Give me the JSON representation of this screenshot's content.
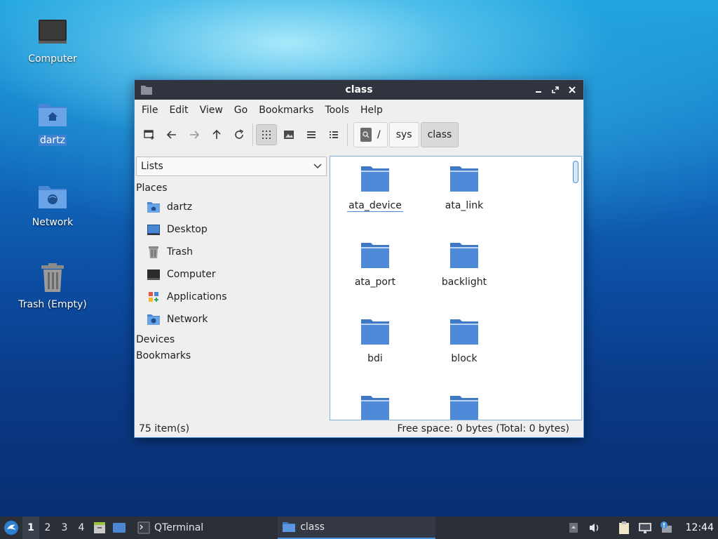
{
  "desktop": {
    "icons": [
      {
        "label": "Computer",
        "icon": "computer-icon"
      },
      {
        "label": "dartz",
        "icon": "home-folder-icon",
        "selected": true
      },
      {
        "label": "Network",
        "icon": "network-folder-icon"
      },
      {
        "label": "Trash (Empty)",
        "icon": "trash-icon"
      }
    ]
  },
  "window": {
    "title": "class",
    "menu": [
      "File",
      "Edit",
      "View",
      "Go",
      "Bookmarks",
      "Tools",
      "Help"
    ],
    "breadcrumb": [
      "/",
      "sys",
      "class"
    ],
    "side": {
      "view_mode": "Lists",
      "places_label": "Places",
      "places": [
        {
          "label": "dartz",
          "icon": "home-folder-icon"
        },
        {
          "label": "Desktop",
          "icon": "desktop-icon"
        },
        {
          "label": "Trash",
          "icon": "trash-icon"
        },
        {
          "label": "Computer",
          "icon": "computer-icon"
        },
        {
          "label": "Applications",
          "icon": "applications-icon"
        },
        {
          "label": "Network",
          "icon": "network-folder-icon"
        }
      ],
      "devices_label": "Devices",
      "bookmarks_label": "Bookmarks"
    },
    "files": [
      "ata_device",
      "ata_link",
      "ata_port",
      "backlight",
      "bdi",
      "block",
      "",
      ""
    ],
    "status": {
      "items": "75 item(s)",
      "free_space": "Free space: 0 bytes (Total: 0 bytes)"
    }
  },
  "taskbar": {
    "workspaces": [
      "1",
      "2",
      "3",
      "4"
    ],
    "active_workspace": "1",
    "tasks": [
      {
        "label": "QTerminal",
        "icon": "terminal-icon"
      },
      {
        "label": "class",
        "icon": "folder-icon",
        "active": true
      }
    ],
    "clock": "12:44"
  },
  "colors": {
    "folder": "#4a86d4",
    "folder_light": "#6aa3e6",
    "titlebar": "#2f343f",
    "accent": "#4a90d9"
  }
}
